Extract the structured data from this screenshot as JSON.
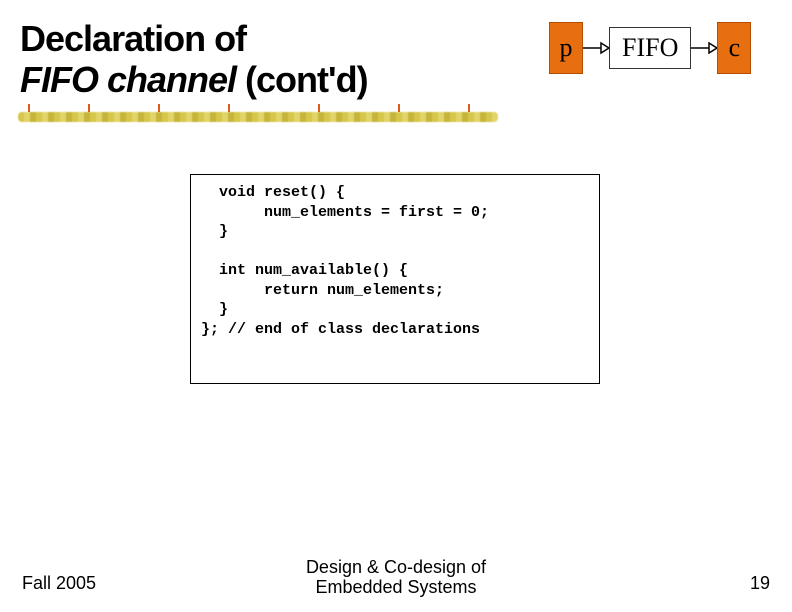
{
  "title": {
    "line1": "Declaration of",
    "line2_italic": "FIFO channel",
    "line2_plain": " (cont'd)"
  },
  "diagram": {
    "p_label": "p",
    "fifo_label": "FIFO",
    "c_label": "c"
  },
  "code": "  void reset() {\n       num_elements = first = 0;\n  }\n\n  int num_available() {\n       return num_elements;\n  }\n}; // end of class declarations",
  "footer": {
    "left": "Fall 2005",
    "center_line1": "Design & Co-design of",
    "center_line2": "Embedded Systems",
    "page": "19"
  }
}
